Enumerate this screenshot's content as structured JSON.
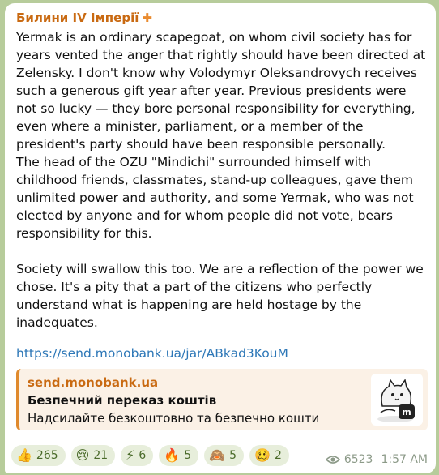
{
  "message": {
    "channel_name": "Билини IV Імперії",
    "channel_badge": "✚",
    "paragraphs": [
      "Yermak is an ordinary scapegoat, on whom civil society has for years vented the anger that rightly should have been directed at Zelensky. I don't know why Volodymyr Oleksandrovych receives such a generous gift year after year. Previous presidents were not so lucky — they bore personal responsibility for everything, even where a minister, parliament, or a member of the president's party should have been responsible personally.",
      "The head of the OZU \"Mindichi\" surrounded himself with childhood friends, classmates, stand-up colleagues, gave them unlimited power and authority, and some Yermak, who was not elected by anyone and for whom people did not vote, bears responsibility for this.",
      "Society will swallow this too. We are a reflection of the power we chose. It's a pity that a part of the citizens who perfectly understand what is happening are held hostage by the inadequates."
    ],
    "link": "https://send.monobank.ua/jar/ABkad3KouM"
  },
  "preview": {
    "site": "send.monobank.ua",
    "title": "Безпечний переказ коштів",
    "description": "Надсилайте безкоштовно та безпечно кошти",
    "thumb_letter": "m"
  },
  "reactions": [
    {
      "emoji": "👍",
      "count": "265"
    },
    {
      "emoji": "😢",
      "count": "21"
    },
    {
      "emoji": "⚡",
      "count": "6"
    },
    {
      "emoji": "🔥",
      "count": "5"
    },
    {
      "emoji": "🙈",
      "count": "5"
    },
    {
      "emoji": "🥴",
      "count": "2"
    }
  ],
  "meta": {
    "icon": "eye-icon",
    "views": "6523",
    "time": "1:57 AM"
  },
  "colors": {
    "background": "#b7cc9b",
    "channel_name": "#c96a12",
    "link": "#2d77b7",
    "preview_bar": "#e08a2d",
    "reaction_bg": "#e7eedb"
  }
}
